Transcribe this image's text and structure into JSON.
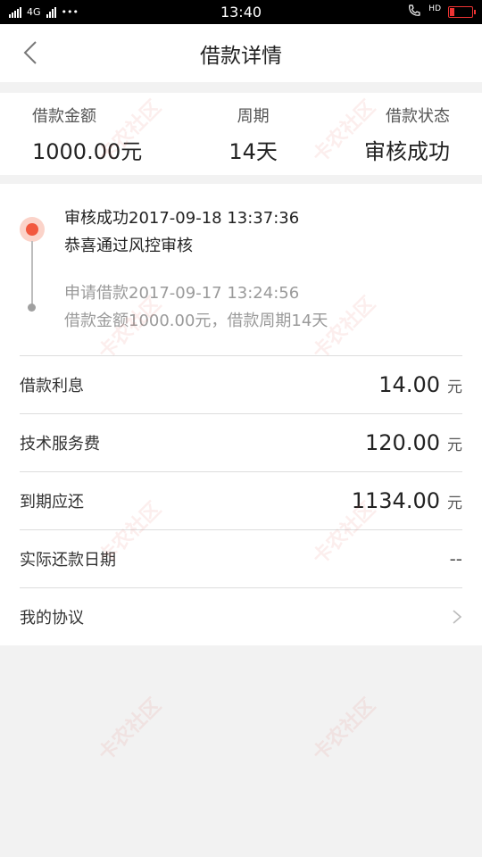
{
  "status_bar": {
    "time": "13:40",
    "signal_text": "4G",
    "hd_text": "HD"
  },
  "nav": {
    "title": "借款详情",
    "back_icon": "chevron-left-icon"
  },
  "summary": {
    "amount_label": "借款金额",
    "amount_value": "1000.00元",
    "period_label": "周期",
    "period_value": "14天",
    "status_label": "借款状态",
    "status_value": "审核成功"
  },
  "timeline": [
    {
      "line1": "审核成功2017-09-18 13:37:36",
      "line2": "恭喜通过风控审核"
    },
    {
      "line1": "申请借款2017-09-17 13:24:56",
      "line2": "借款金额1000.00元，借款周期14天"
    }
  ],
  "rows": {
    "interest_label": "借款利息",
    "interest_value": "14.00",
    "interest_unit": "元",
    "service_label": "技术服务费",
    "service_value": "120.00",
    "service_unit": "元",
    "due_label": "到期应还",
    "due_value": "1134.00",
    "due_unit": "元",
    "repay_date_label": "实际还款日期",
    "repay_date_value": "--",
    "agreement_label": "我的协议"
  },
  "watermark": "卡农社区",
  "colors": {
    "accent": "#f2583e",
    "background": "#f2f2f2"
  }
}
